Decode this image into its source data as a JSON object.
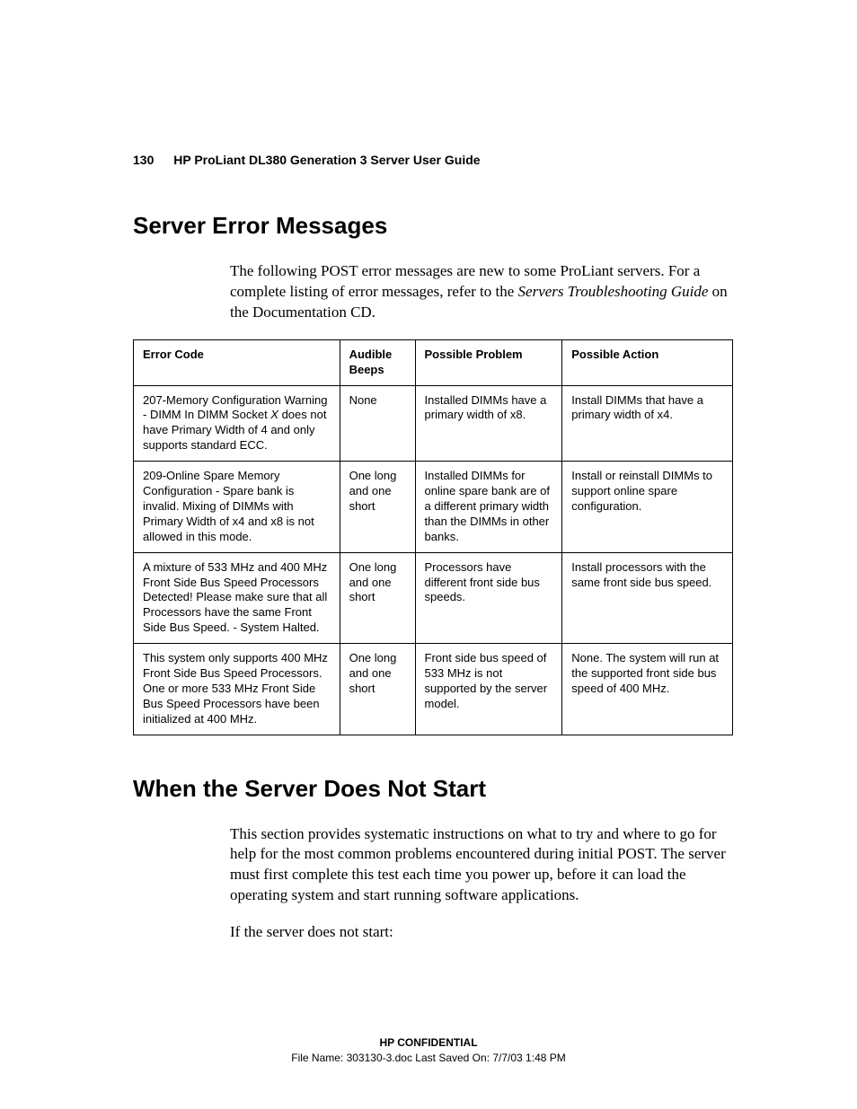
{
  "header": {
    "page_number": "130",
    "doc_title": "HP ProLiant DL380 Generation 3 Server User Guide"
  },
  "section1": {
    "heading": "Server Error Messages",
    "intro_pre": "The following POST error messages are new to some ProLiant servers. For a complete listing of error messages, refer to the ",
    "intro_ref": "Servers Troubleshooting Guide",
    "intro_post": " on the Documentation CD.",
    "table": {
      "headers": [
        "Error Code",
        "Audible Beeps",
        "Possible Problem",
        "Possible Action"
      ],
      "rows": [
        {
          "c0_pre": "207-Memory Configuration Warning - DIMM In DIMM Socket ",
          "c0_ital": "X",
          "c0_post": " does not have Primary Width of 4 and only supports standard ECC.",
          "c1": "None",
          "c2": "Installed DIMMs have a primary width of x8.",
          "c3": "Install DIMMs that have a primary width of x4."
        },
        {
          "c0_pre": "209-Online Spare Memory Configuration - Spare bank is invalid. Mixing of DIMMs with Primary Width of x4 and x8 is not allowed in this mode.",
          "c0_ital": "",
          "c0_post": "",
          "c1": "One long and one short",
          "c2": "Installed DIMMs for online spare bank are of a different primary width than the DIMMs in other banks.",
          "c3": "Install or reinstall DIMMs to support online spare configuration."
        },
        {
          "c0_pre": "A mixture of 533 MHz and 400 MHz Front Side Bus Speed Processors Detected! Please make sure that all Processors have the same Front Side Bus Speed. - System Halted.",
          "c0_ital": "",
          "c0_post": "",
          "c1": "One long and one short",
          "c2": "Processors have different front side bus speeds.",
          "c3": "Install processors with the same front side bus speed."
        },
        {
          "c0_pre": "This system only supports 400 MHz Front Side Bus Speed Processors. One or more 533 MHz Front Side Bus Speed Processors have been initialized at 400 MHz.",
          "c0_ital": "",
          "c0_post": "",
          "c1": "One long and one short",
          "c2": "Front side bus speed of 533 MHz is not supported by the server model.",
          "c3": "None. The system will run at the supported front side bus speed of 400 MHz."
        }
      ]
    }
  },
  "section2": {
    "heading": "When the Server Does Not Start",
    "para1": "This section provides systematic instructions on what to try and where to go for help for the most common problems encountered during initial POST. The server must first complete this test each time you power up, before it can load the operating system and start running software applications.",
    "para2": "If the server does not start:"
  },
  "footer": {
    "confidential": "HP CONFIDENTIAL",
    "meta": "File Name: 303130-3.doc   Last Saved On: 7/7/03 1:48 PM"
  }
}
